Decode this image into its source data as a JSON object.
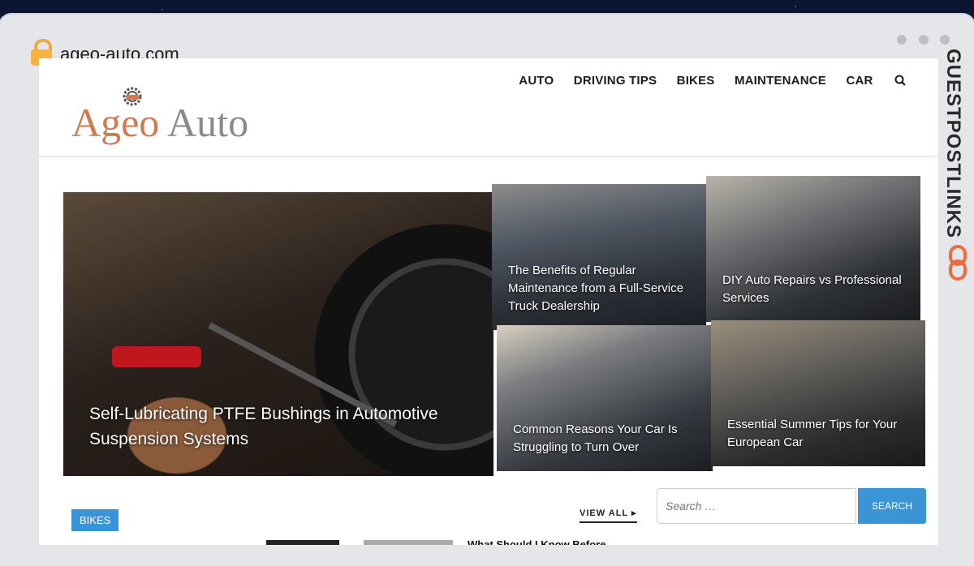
{
  "browser": {
    "url": "ageo-auto.com"
  },
  "logo": {
    "part1": "Ageo",
    "part2": "Auto"
  },
  "nav": {
    "items": [
      "AUTO",
      "DRIVING TIPS",
      "BIKES",
      "MAINTENANCE",
      "CAR"
    ]
  },
  "featured": [
    {
      "title": "Self-Lubricating PTFE Bushings in Automotive Suspension Systems"
    },
    {
      "title": "The Benefits of Regular Maintenance from a Full-Service Truck Dealership"
    },
    {
      "title": "DIY Auto Repairs vs Professional Services"
    },
    {
      "title": "Common Reasons Your Car Is Struggling to Turn Over"
    },
    {
      "title": "Essential Summer Tips for Your European Car"
    }
  ],
  "section": {
    "badge": "BIKES",
    "view_all": "VIEW ALL",
    "teaser": "What Should I Know Before"
  },
  "search": {
    "placeholder": "Search …",
    "button": "SEARCH"
  },
  "side_brand": "GUESTPOSTLINKS",
  "colors": {
    "accent": "#3a94d6",
    "logo_primary": "#d17a52",
    "logo_secondary": "#8a8a8a"
  }
}
